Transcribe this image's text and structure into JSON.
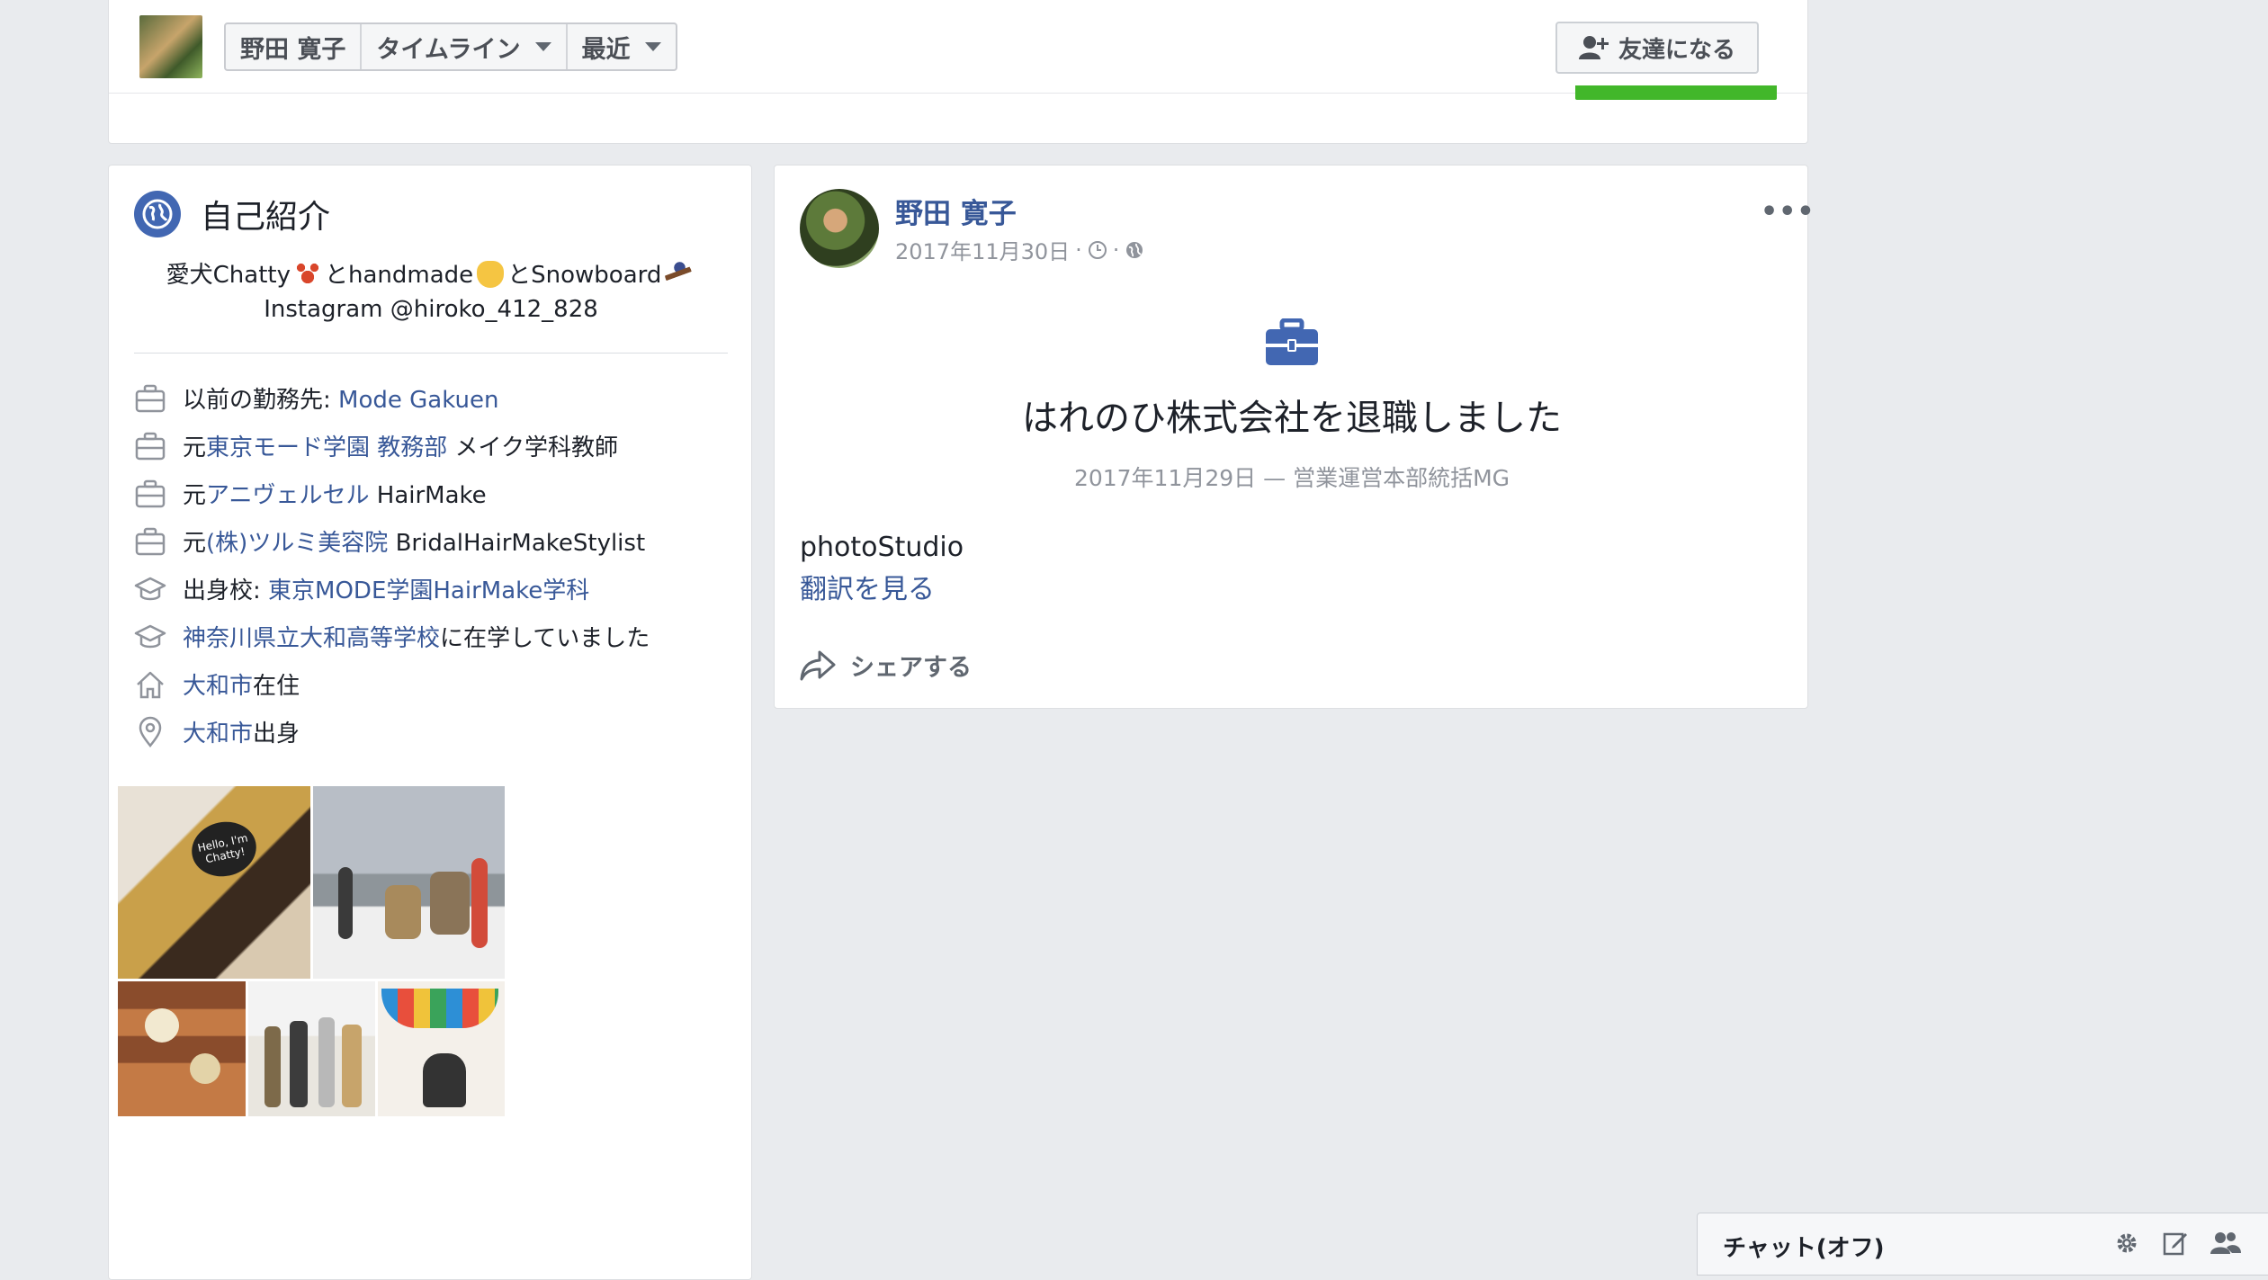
{
  "topbar": {
    "name": "野田 寛子",
    "timeline_label": "タイムライン",
    "recent_label": "最近",
    "add_friend_label": "友達になる"
  },
  "intro": {
    "title": "自己紹介",
    "bio_line1": {
      "a": "愛犬Chatty",
      "b": "とhandmade",
      "c": "とSnowboard"
    },
    "bio_line2": "Instagram @hiroko_412_828",
    "facts": [
      {
        "icon": "briefcase-icon",
        "prefix": "以前の勤務先: ",
        "link": "Mode Gakuen",
        "suffix": ""
      },
      {
        "icon": "briefcase-icon",
        "prefix": "元",
        "link": "東京モード学園 教務部",
        "suffix": " メイク学科教師"
      },
      {
        "icon": "briefcase-icon",
        "prefix": "元",
        "link": "アニヴェルセル",
        "suffix": " HairMake"
      },
      {
        "icon": "briefcase-icon",
        "prefix": "元",
        "link": "(株)ツルミ美容院",
        "suffix": " BridalHairMakeStylist"
      },
      {
        "icon": "graduation-cap-icon",
        "prefix": "出身校: ",
        "link": "東京MODE学園HairMake学科",
        "suffix": ""
      },
      {
        "icon": "graduation-cap-icon",
        "prefix": "",
        "link": "神奈川県立大和高等学校",
        "suffix": "に在学していました"
      },
      {
        "icon": "home-icon",
        "prefix": "",
        "link": "大和市",
        "suffix": "在住"
      },
      {
        "icon": "location-pin-icon",
        "prefix": "",
        "link": "大和市",
        "suffix": "出身"
      }
    ],
    "photo_sign": "Hello, I'm Chatty!"
  },
  "post": {
    "author": "野田 寛子",
    "date": "2017年11月30日",
    "event_title": "はれのひ株式会社を退職しました",
    "event_date": "2017年11月29日",
    "event_dash": " — ",
    "event_role": "営業運営本部統括MG",
    "text": "photoStudio",
    "translate_label": "翻訳を見る",
    "share_label": "シェアする"
  },
  "chat": {
    "label": "チャット(オフ)"
  },
  "colors": {
    "background": "#e9ebee",
    "link": "#385898",
    "accent": "#4267b2",
    "green": "#42b72a"
  }
}
